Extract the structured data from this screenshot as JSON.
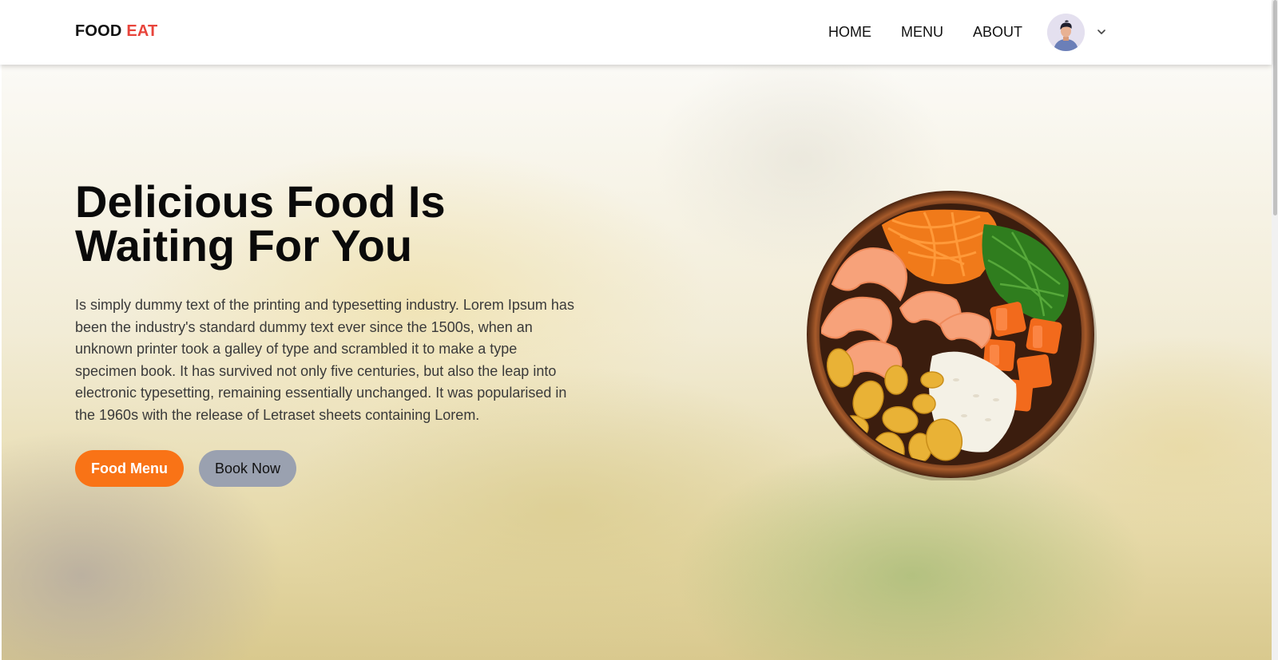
{
  "brand": {
    "first": "FOOD",
    "second": "EAT",
    "accent_color": "#e8453c"
  },
  "nav": {
    "items": [
      {
        "label": "HOME"
      },
      {
        "label": "MENU"
      },
      {
        "label": "ABOUT"
      }
    ],
    "avatar_icon": "user-avatar",
    "dropdown_icon": "chevron-down-icon"
  },
  "hero": {
    "title_line1": "Delicious Food Is",
    "title_line2": "Waiting For You",
    "description": "Is simply dummy text of the printing and typesetting industry. Lorem Ipsum has been the industry's standard dummy text ever since the 1500s, when an unknown printer took a galley of type and scrambled it to make a type specimen book. It has survived not only five centuries, but also the leap into electronic typesetting, remaining essentially unchanged. It was popularised in the 1960s with the release of Letraset sheets containing Lorem.",
    "primary_button": "Food Menu",
    "secondary_button": "Book Now",
    "primary_color": "#f97316",
    "secondary_color": "#9aa1b0"
  }
}
